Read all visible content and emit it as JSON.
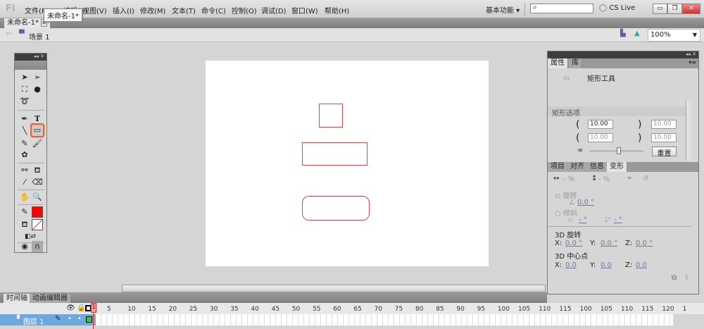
{
  "app": {
    "logo": "Fl"
  },
  "menu": [
    "文件(F)",
    "编辑(E)",
    "视图(V)",
    "插入(I)",
    "修改(M)",
    "文本(T)",
    "命令(C)",
    "控制(O)",
    "调试(D)",
    "窗口(W)",
    "帮助(H)"
  ],
  "tooltip": "未命名-1*",
  "workspace": "基本功能 ▾",
  "cs_live": "CS Live",
  "document_tab": "未命名-1*",
  "scene": "场景 1",
  "zoom": "100%",
  "toolbox": {
    "collapse": "◂◂ ✕"
  },
  "properties": {
    "tabs": [
      "属性",
      "库"
    ],
    "tool_name": "矩形工具",
    "section": "矩形选项",
    "corners": [
      "10.00",
      "10.00",
      "10.00",
      "10.00"
    ],
    "reset": "重置"
  },
  "transform": {
    "tabs": [
      "项目",
      "对齐",
      "信息",
      "变形"
    ],
    "width_pct": "- %",
    "height_pct": "- %",
    "rotate_label": "旋转",
    "rotate_val": "0.0 °",
    "skew_label": "倾斜",
    "skew_h": "- °",
    "skew_v": "- °",
    "rot3d_label": "3D 旋转",
    "rot3d": {
      "x": "0.0 °",
      "y": "0.0 °",
      "z": "0.0 °"
    },
    "center3d_label": "3D 中心点",
    "center3d": {
      "x": "0.0",
      "y": "0.0",
      "z": "0.0"
    }
  },
  "timeline": {
    "tabs": [
      "时间轴",
      "动画编辑器"
    ],
    "layer": "图层 1",
    "ruler": [
      "1",
      "5",
      "10",
      "15",
      "20",
      "25",
      "30",
      "35",
      "40",
      "45",
      "50",
      "55",
      "60",
      "65",
      "70",
      "75",
      "80",
      "85",
      "90",
      "95",
      "100",
      "105",
      "110",
      "115",
      "100",
      "105",
      "110",
      "115",
      "120",
      "1"
    ]
  },
  "colors": {
    "stroke": "#ff0000",
    "shape_stroke": "#c05050",
    "highlight": "#ff5a1f"
  }
}
